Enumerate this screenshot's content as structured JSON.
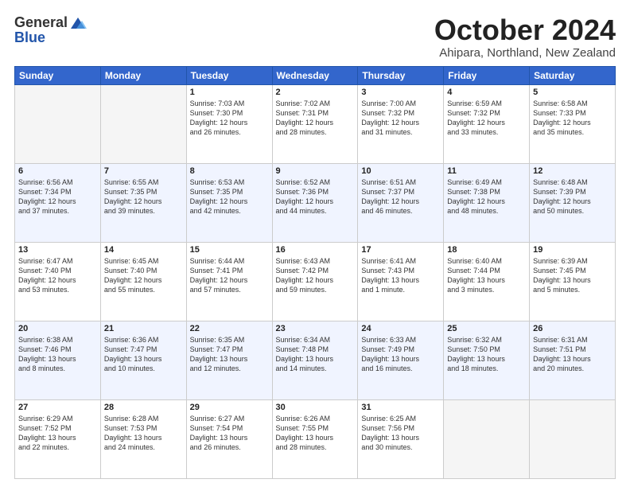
{
  "header": {
    "logo_general": "General",
    "logo_blue": "Blue",
    "month_title": "October 2024",
    "location": "Ahipara, Northland, New Zealand"
  },
  "weekdays": [
    "Sunday",
    "Monday",
    "Tuesday",
    "Wednesday",
    "Thursday",
    "Friday",
    "Saturday"
  ],
  "weeks": [
    [
      {
        "day": "",
        "info": ""
      },
      {
        "day": "",
        "info": ""
      },
      {
        "day": "1",
        "info": "Sunrise: 7:03 AM\nSunset: 7:30 PM\nDaylight: 12 hours\nand 26 minutes."
      },
      {
        "day": "2",
        "info": "Sunrise: 7:02 AM\nSunset: 7:31 PM\nDaylight: 12 hours\nand 28 minutes."
      },
      {
        "day": "3",
        "info": "Sunrise: 7:00 AM\nSunset: 7:32 PM\nDaylight: 12 hours\nand 31 minutes."
      },
      {
        "day": "4",
        "info": "Sunrise: 6:59 AM\nSunset: 7:32 PM\nDaylight: 12 hours\nand 33 minutes."
      },
      {
        "day": "5",
        "info": "Sunrise: 6:58 AM\nSunset: 7:33 PM\nDaylight: 12 hours\nand 35 minutes."
      }
    ],
    [
      {
        "day": "6",
        "info": "Sunrise: 6:56 AM\nSunset: 7:34 PM\nDaylight: 12 hours\nand 37 minutes."
      },
      {
        "day": "7",
        "info": "Sunrise: 6:55 AM\nSunset: 7:35 PM\nDaylight: 12 hours\nand 39 minutes."
      },
      {
        "day": "8",
        "info": "Sunrise: 6:53 AM\nSunset: 7:35 PM\nDaylight: 12 hours\nand 42 minutes."
      },
      {
        "day": "9",
        "info": "Sunrise: 6:52 AM\nSunset: 7:36 PM\nDaylight: 12 hours\nand 44 minutes."
      },
      {
        "day": "10",
        "info": "Sunrise: 6:51 AM\nSunset: 7:37 PM\nDaylight: 12 hours\nand 46 minutes."
      },
      {
        "day": "11",
        "info": "Sunrise: 6:49 AM\nSunset: 7:38 PM\nDaylight: 12 hours\nand 48 minutes."
      },
      {
        "day": "12",
        "info": "Sunrise: 6:48 AM\nSunset: 7:39 PM\nDaylight: 12 hours\nand 50 minutes."
      }
    ],
    [
      {
        "day": "13",
        "info": "Sunrise: 6:47 AM\nSunset: 7:40 PM\nDaylight: 12 hours\nand 53 minutes."
      },
      {
        "day": "14",
        "info": "Sunrise: 6:45 AM\nSunset: 7:40 PM\nDaylight: 12 hours\nand 55 minutes."
      },
      {
        "day": "15",
        "info": "Sunrise: 6:44 AM\nSunset: 7:41 PM\nDaylight: 12 hours\nand 57 minutes."
      },
      {
        "day": "16",
        "info": "Sunrise: 6:43 AM\nSunset: 7:42 PM\nDaylight: 12 hours\nand 59 minutes."
      },
      {
        "day": "17",
        "info": "Sunrise: 6:41 AM\nSunset: 7:43 PM\nDaylight: 13 hours\nand 1 minute."
      },
      {
        "day": "18",
        "info": "Sunrise: 6:40 AM\nSunset: 7:44 PM\nDaylight: 13 hours\nand 3 minutes."
      },
      {
        "day": "19",
        "info": "Sunrise: 6:39 AM\nSunset: 7:45 PM\nDaylight: 13 hours\nand 5 minutes."
      }
    ],
    [
      {
        "day": "20",
        "info": "Sunrise: 6:38 AM\nSunset: 7:46 PM\nDaylight: 13 hours\nand 8 minutes."
      },
      {
        "day": "21",
        "info": "Sunrise: 6:36 AM\nSunset: 7:47 PM\nDaylight: 13 hours\nand 10 minutes."
      },
      {
        "day": "22",
        "info": "Sunrise: 6:35 AM\nSunset: 7:47 PM\nDaylight: 13 hours\nand 12 minutes."
      },
      {
        "day": "23",
        "info": "Sunrise: 6:34 AM\nSunset: 7:48 PM\nDaylight: 13 hours\nand 14 minutes."
      },
      {
        "day": "24",
        "info": "Sunrise: 6:33 AM\nSunset: 7:49 PM\nDaylight: 13 hours\nand 16 minutes."
      },
      {
        "day": "25",
        "info": "Sunrise: 6:32 AM\nSunset: 7:50 PM\nDaylight: 13 hours\nand 18 minutes."
      },
      {
        "day": "26",
        "info": "Sunrise: 6:31 AM\nSunset: 7:51 PM\nDaylight: 13 hours\nand 20 minutes."
      }
    ],
    [
      {
        "day": "27",
        "info": "Sunrise: 6:29 AM\nSunset: 7:52 PM\nDaylight: 13 hours\nand 22 minutes."
      },
      {
        "day": "28",
        "info": "Sunrise: 6:28 AM\nSunset: 7:53 PM\nDaylight: 13 hours\nand 24 minutes."
      },
      {
        "day": "29",
        "info": "Sunrise: 6:27 AM\nSunset: 7:54 PM\nDaylight: 13 hours\nand 26 minutes."
      },
      {
        "day": "30",
        "info": "Sunrise: 6:26 AM\nSunset: 7:55 PM\nDaylight: 13 hours\nand 28 minutes."
      },
      {
        "day": "31",
        "info": "Sunrise: 6:25 AM\nSunset: 7:56 PM\nDaylight: 13 hours\nand 30 minutes."
      },
      {
        "day": "",
        "info": ""
      },
      {
        "day": "",
        "info": ""
      }
    ]
  ]
}
